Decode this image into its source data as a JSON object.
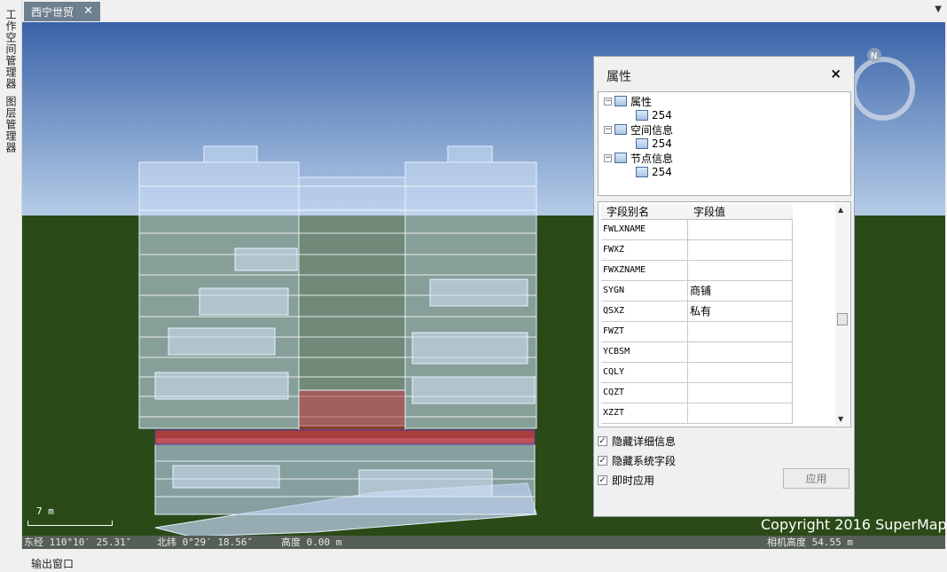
{
  "left_panel": {
    "workspace_manager": "工作空间管理器",
    "layer_manager": "图层管理器"
  },
  "document_tab": {
    "title": "西宁世贸",
    "close": "✕"
  },
  "properties_panel": {
    "title": "属性",
    "close": "×",
    "tree": [
      {
        "label": "属性",
        "child": "254"
      },
      {
        "label": "空间信息",
        "child": "254"
      },
      {
        "label": "节点信息",
        "child": "254"
      }
    ],
    "grid": {
      "headers": [
        "字段别名",
        "字段值"
      ],
      "rows": [
        {
          "name": "FWLXNAME",
          "value": ""
        },
        {
          "name": "FWXZ",
          "value": ""
        },
        {
          "name": "FWXZNAME",
          "value": ""
        },
        {
          "name": "SYGN",
          "value": "商铺"
        },
        {
          "name": "QSXZ",
          "value": "私有"
        },
        {
          "name": "FWZT",
          "value": ""
        },
        {
          "name": "YCBSM",
          "value": ""
        },
        {
          "name": "CQLY",
          "value": ""
        },
        {
          "name": "CQZT",
          "value": ""
        },
        {
          "name": "XZZT",
          "value": ""
        }
      ]
    },
    "options": {
      "hide_details": "隐藏详细信息",
      "hide_system_fields": "隐藏系统字段",
      "instant_apply": "即时应用"
    },
    "apply_button": "应用"
  },
  "scene": {
    "copyright": "Copyright 2016 SuperMap",
    "scale_label": "7 m",
    "compass_label": "N"
  },
  "status": {
    "longitude": "东经 110°10′ 25.31″",
    "latitude": "北纬 0°29′ 18.56″",
    "height": "高度 0.00 m",
    "camera_height": "相机高度 54.55 m"
  },
  "bottom": {
    "output_window": "输出窗口"
  },
  "colors": {
    "sky_top": "#3a63a8",
    "sky_bottom": "#bcd2ec",
    "ground": "#2a4a17",
    "highlight": "#c83c46"
  }
}
